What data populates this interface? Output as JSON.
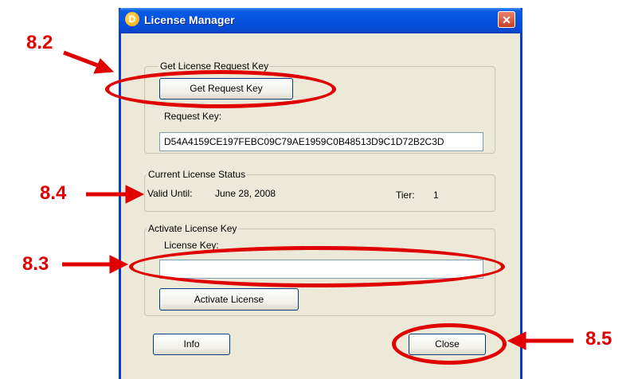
{
  "window": {
    "title": "License Manager",
    "app_icon": "D",
    "close_glyph": "✕"
  },
  "request_group": {
    "legend": "Get License Request Key",
    "get_button_label": "Get Request Key",
    "request_key_label": "Request Key:",
    "request_key_value": "D54A4159CE197FEBC09C79AE1959C0B48513D9C1D72B2C3D"
  },
  "status_group": {
    "legend": "Current License Status",
    "valid_label": "Valid Until:",
    "valid_value": "June 28, 2008",
    "tier_label": "Tier:",
    "tier_value": "1"
  },
  "activate_group": {
    "legend": "Activate License Key",
    "license_key_label": "License Key:",
    "license_key_value": "",
    "activate_button_label": "Activate License"
  },
  "footer": {
    "info_label": "Info",
    "close_label": "Close"
  },
  "annotations": {
    "m82": "8.2",
    "m84": "8.4",
    "m83": "8.3",
    "m85": "8.5",
    "color": "#e00000"
  }
}
